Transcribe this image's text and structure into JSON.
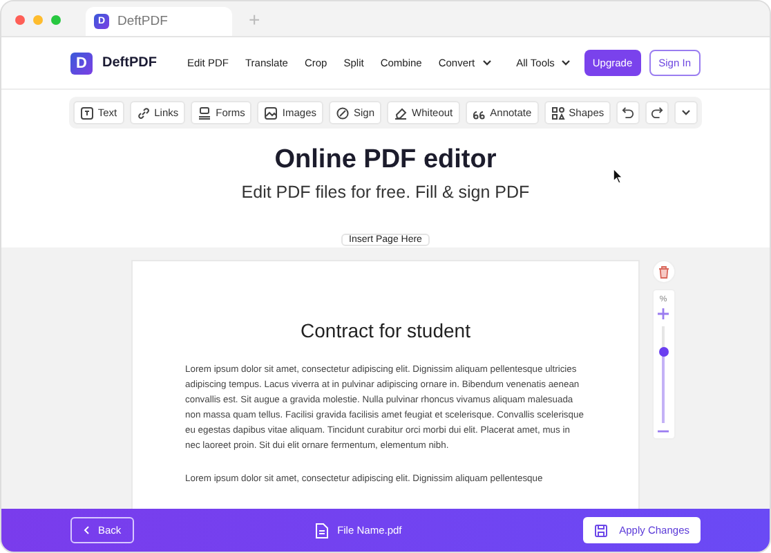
{
  "browser": {
    "tab_title": "DeftPDF",
    "favicon_letter": "D",
    "new_tab": "+"
  },
  "nav": {
    "brand": "DeftPDF",
    "logo_letter": "D",
    "items": [
      {
        "label": "Edit PDF",
        "dropdown": false
      },
      {
        "label": "Translate",
        "dropdown": false
      },
      {
        "label": "Crop",
        "dropdown": false
      },
      {
        "label": "Split",
        "dropdown": false
      },
      {
        "label": "Combine",
        "dropdown": false
      },
      {
        "label": "Convert",
        "dropdown": true
      },
      {
        "label": "All Tools",
        "dropdown": true
      }
    ],
    "upgrade": "Upgrade",
    "sign_in": "Sign In"
  },
  "toolbar": [
    "Text",
    "Links",
    "Forms",
    "Images",
    "Sign",
    "Whiteout",
    "Annotate",
    "Shapes"
  ],
  "hero": {
    "title": "Online PDF editor",
    "subtitle": "Edit PDF files for free. Fill & sign PDF"
  },
  "insert_page": "Insert Page Here",
  "document": {
    "title": "Contract for student",
    "paragraphs": [
      "Lorem ipsum dolor sit amet, consectetur adipiscing elit. Dignissim aliquam pellentesque ultricies adipiscing tempus. Lacus viverra at in pulvinar adipiscing ornare in. Bibendum venenatis aenean convallis est. Sit augue a gravida molestie. Nulla pulvinar rhoncus vivamus aliquam malesuada non massa quam tellus. Facilisi gravida facilisis amet feugiat et scelerisque. Convallis scelerisque eu egestas dapibus vitae aliquam. Tincidunt curabitur orci morbi dui elit. Placerat amet, mus in nec laoreet proin. Sit dui elit ornare fermentum, elementum nibh.",
      "Lorem ipsum dolor sit amet, consectetur adipiscing elit. Dignissim aliquam pellentesque"
    ]
  },
  "zoom": {
    "unit": "%",
    "level": 0.75
  },
  "bottom_bar": {
    "back": "Back",
    "file_name": "File Name.pdf",
    "apply": "Apply Changes"
  }
}
